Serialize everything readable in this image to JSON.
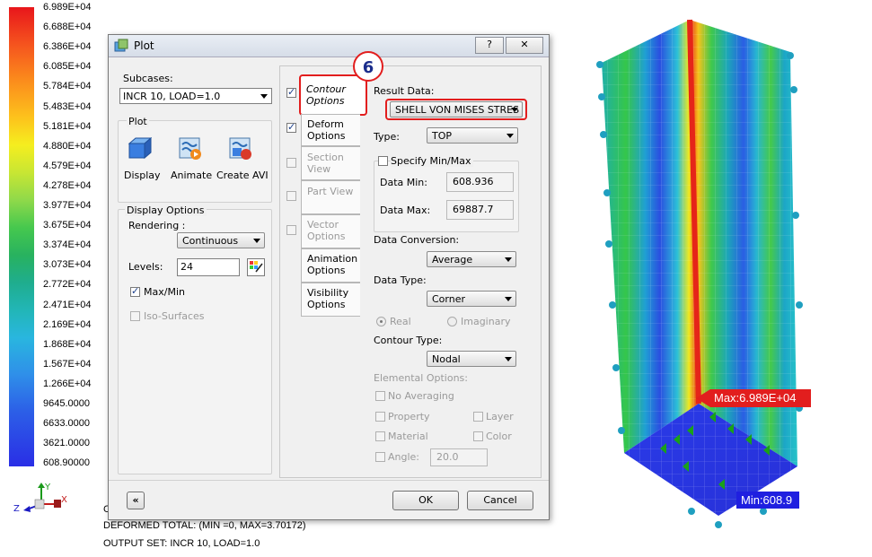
{
  "legend": {
    "values": [
      "6.989E+04",
      "6.688E+04",
      "6.386E+04",
      "6.085E+04",
      "5.784E+04",
      "5.483E+04",
      "5.181E+04",
      "4.880E+04",
      "4.579E+04",
      "4.278E+04",
      "3.977E+04",
      "3.675E+04",
      "3.374E+04",
      "3.073E+04",
      "2.772E+04",
      "2.471E+04",
      "2.169E+04",
      "1.868E+04",
      "1.567E+04",
      "1.266E+04",
      "9645.0000",
      "6633.0000",
      "3621.0000",
      "608.90000"
    ]
  },
  "axes_triad": {
    "x": "X",
    "y": "Y",
    "z": "Z"
  },
  "status": {
    "line1_fragment": "C",
    "line2": "DEFORMED TOTAL: (MIN     =0, MAX=3.70172)",
    "line3": "OUTPUT SET: INCR 10, LOAD=1.0"
  },
  "dialog": {
    "title": "Plot",
    "help_label": "?",
    "close_label": "✕",
    "subcases_label": "Subcases:",
    "subcase_value": "INCR 10, LOAD=1.0",
    "plot_group": {
      "title": "Plot",
      "buttons": [
        {
          "label": "Display",
          "icon": "display-icon"
        },
        {
          "label": "Animate",
          "icon": "animate-icon"
        },
        {
          "label": "Create AVI",
          "icon": "create-avi-icon"
        }
      ]
    },
    "display_options": {
      "title": "Display Options",
      "rendering_label": "Rendering :",
      "rendering_value": "Continuous",
      "levels_label": "Levels:",
      "levels_value": "24",
      "maxmin_label": "Max/Min",
      "maxmin_checked": true,
      "iso_label": "Iso-Surfaces",
      "iso_checked": false
    },
    "tabs": [
      {
        "label1": "Contour",
        "label2": "Options",
        "checked": true,
        "active": true
      },
      {
        "label1": "Deform",
        "label2": "Options",
        "checked": true,
        "active": false
      },
      {
        "label1": "Section View",
        "label2": "",
        "checked": false,
        "active": false,
        "disabled": true
      },
      {
        "label1": "Part View",
        "label2": "",
        "checked": false,
        "active": false,
        "disabled": true
      },
      {
        "label1": "Vector",
        "label2": "Options",
        "checked": false,
        "active": false,
        "disabled": true
      },
      {
        "label1": "Animation",
        "label2": "Options",
        "active": false
      },
      {
        "label1": "Visibility",
        "label2": "Options",
        "active": false
      }
    ],
    "step_badge": "6",
    "contour": {
      "result_data_label": "Result Data:",
      "result_data_value": "SHELL VON MISES STRES",
      "type_label": "Type:",
      "type_value": "TOP",
      "specify_minmax_label": "Specify Min/Max",
      "data_min_label": "Data Min:",
      "data_min_value": "608.936",
      "data_max_label": "Data Max:",
      "data_max_value": "69887.7",
      "data_conversion_label": "Data Conversion:",
      "data_conversion_value": "Average",
      "data_type_label": "Data Type:",
      "data_type_value": "Corner",
      "real_label": "Real",
      "imaginary_label": "Imaginary",
      "contour_type_label": "Contour Type:",
      "contour_type_value": "Nodal",
      "elemental_label": "Elemental Options:",
      "no_averaging_label": "No Averaging",
      "property_label": "Property",
      "layer_label": "Layer",
      "material_label": "Material",
      "color_label": "Color",
      "angle_label": "Angle:",
      "angle_value": "20.0"
    },
    "collapse_label": "«",
    "ok_label": "OK",
    "cancel_label": "Cancel"
  },
  "model": {
    "max_label": "Max:6.989E+04",
    "min_label": "Min:608.9"
  }
}
